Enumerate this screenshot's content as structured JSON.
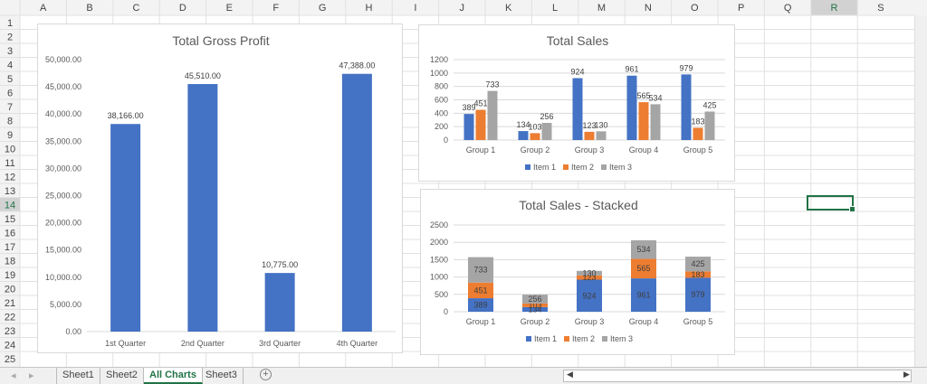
{
  "columns": [
    "A",
    "B",
    "C",
    "D",
    "E",
    "F",
    "G",
    "H",
    "I",
    "J",
    "K",
    "L",
    "M",
    "N",
    "O",
    "P",
    "Q",
    "R",
    "S"
  ],
  "rows": [
    "1",
    "2",
    "3",
    "4",
    "5",
    "6",
    "7",
    "8",
    "9",
    "10",
    "11",
    "12",
    "13",
    "14",
    "15",
    "16",
    "17",
    "18",
    "19",
    "20",
    "21",
    "22",
    "23",
    "24",
    "25"
  ],
  "selected_cell": "R14",
  "sheet_tabs": [
    {
      "label": "Sheet1"
    },
    {
      "label": "Sheet2"
    },
    {
      "label": "All Charts",
      "active": true
    },
    {
      "label": "Sheet3"
    }
  ],
  "add_sheet_icon": "plus-circle-icon",
  "colors": {
    "item1": "#4472c4",
    "item2": "#ed7d31",
    "item3": "#a5a5a5",
    "accent": "#217346"
  },
  "chart_data": [
    {
      "type": "bar",
      "title": "Total Gross Profit",
      "categories": [
        "1st Quarter",
        "2nd Quarter",
        "3rd Quarter",
        "4th Quarter"
      ],
      "values": [
        38166,
        45510,
        10775,
        47388
      ],
      "data_labels": [
        "38,166.00",
        "45,510.00",
        "10,775.00",
        "47,388.00"
      ],
      "ylim": [
        0,
        50000
      ],
      "yticks": [
        "0.00",
        "5,000.00",
        "10,000.00",
        "15,000.00",
        "20,000.00",
        "25,000.00",
        "30,000.00",
        "35,000.00",
        "40,000.00",
        "45,000.00",
        "50,000.00"
      ],
      "legend": "none"
    },
    {
      "type": "bar",
      "title": "Total Sales",
      "categories": [
        "Group 1",
        "Group 2",
        "Group 3",
        "Group 4",
        "Group 5"
      ],
      "series": [
        {
          "name": "Item 1",
          "values": [
            389,
            134,
            924,
            961,
            979
          ]
        },
        {
          "name": "Item 2",
          "values": [
            451,
            103,
            123,
            565,
            183
          ]
        },
        {
          "name": "Item 3",
          "values": [
            733,
            256,
            130,
            534,
            425
          ]
        }
      ],
      "ylim": [
        0,
        1200
      ],
      "yticks": [
        "0",
        "200",
        "400",
        "600",
        "800",
        "1000",
        "1200"
      ],
      "legend": "bottom"
    },
    {
      "type": "bar",
      "stacked": true,
      "title": "Total Sales - Stacked",
      "categories": [
        "Group 1",
        "Group 2",
        "Group 3",
        "Group 4",
        "Group 5"
      ],
      "series": [
        {
          "name": "Item 1",
          "values": [
            389,
            134,
            924,
            961,
            979
          ]
        },
        {
          "name": "Item 2",
          "values": [
            451,
            103,
            123,
            565,
            183
          ]
        },
        {
          "name": "Item 3",
          "values": [
            733,
            256,
            130,
            534,
            425
          ]
        }
      ],
      "ylim": [
        0,
        2500
      ],
      "yticks": [
        "0",
        "500",
        "1000",
        "1500",
        "2000",
        "2500"
      ],
      "legend": "bottom"
    }
  ]
}
